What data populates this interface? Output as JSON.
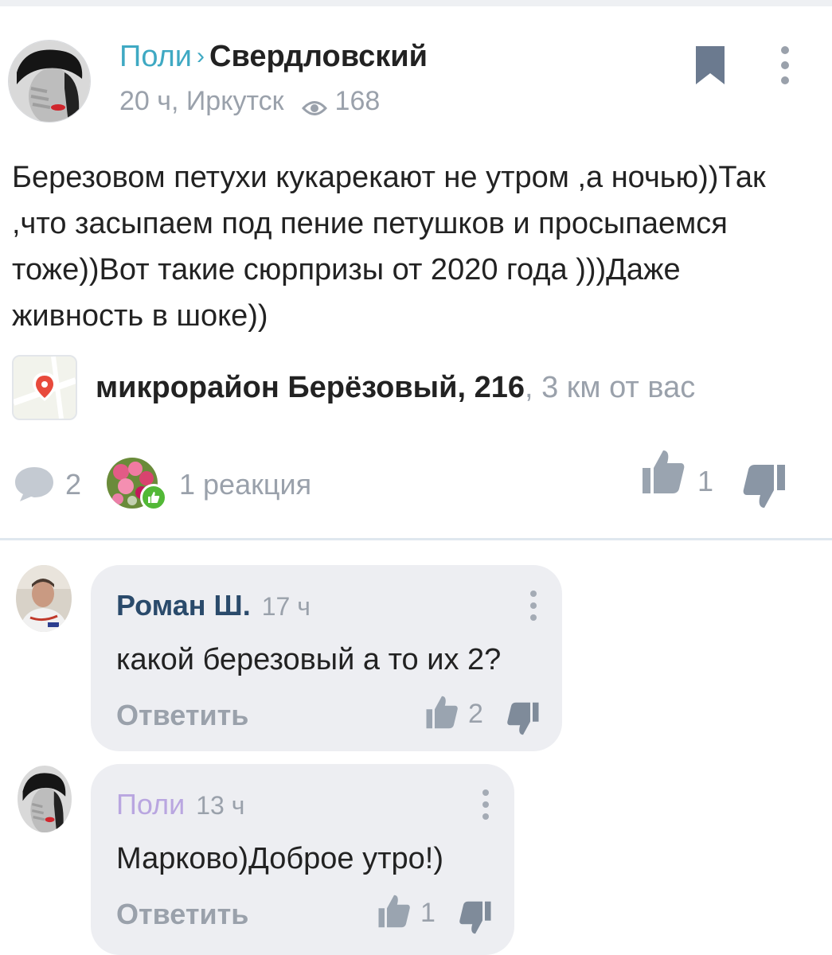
{
  "post": {
    "author": "Поли",
    "separator": "›",
    "channel": "Свердловский",
    "time_location": "20 ч, Иркутск",
    "views": "168",
    "text": "Березовом петухи кукарекают не утром ,а ночью))Так ,что засыпаем под пение петушков и просыпаемся тоже))Вот такие сюрпризы от 2020 года )))Даже живность в шоке))",
    "location_name": "микрорайон Берёзовый, 216",
    "location_distance": ", 3 км от вас",
    "comments_count": "2",
    "reactions_label": "1 реакция",
    "likes": "1"
  },
  "comments": [
    {
      "author": "Роман Ш.",
      "time": "17 ч",
      "text": "какой березовый а то их 2?",
      "reply_label": "Ответить",
      "likes": "2",
      "author_color": "#2a4a6b"
    },
    {
      "author": "Поли",
      "time": "13 ч",
      "text": "Марково)Доброе утро!)",
      "reply_label": "Ответить",
      "likes": "1",
      "author_color": "#b9a6e0"
    }
  ],
  "colors": {
    "accent": "#3fa9c3",
    "muted": "#9aa1ab",
    "bubble": "#edeef2",
    "reaction_badge": "#52b836"
  },
  "icons": [
    "bookmark-icon",
    "more-vertical-icon",
    "eye-icon",
    "map-pin-icon",
    "comment-icon",
    "like-icon",
    "dislike-icon"
  ]
}
